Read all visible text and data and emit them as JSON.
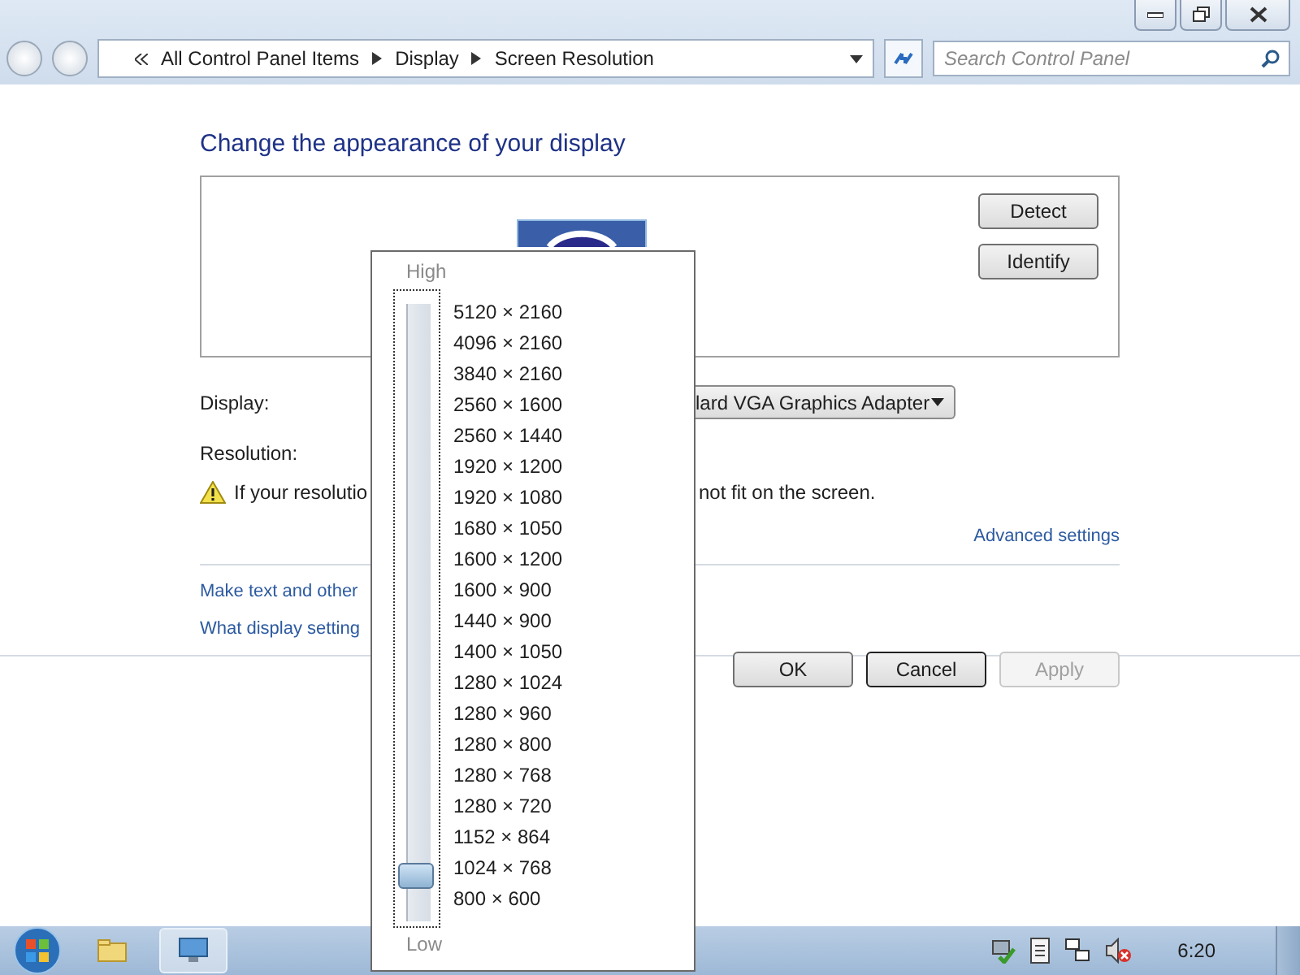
{
  "window": {
    "breadcrumb": [
      "All Control Panel Items",
      "Display",
      "Screen Resolution"
    ],
    "search": {
      "placeholder": "Search Control Panel"
    }
  },
  "heading": "Change the appearance of your display",
  "preview_buttons": [
    "Detect",
    "Identify"
  ],
  "display": {
    "label": "Display:",
    "value": "lard VGA Graphics Adapter"
  },
  "resolution": {
    "label": "Resolution:"
  },
  "warning": {
    "left": "If your resolutio",
    "right": "not fit on the screen."
  },
  "advanced_link": "Advanced settings",
  "links": [
    "Make text and other",
    "What display setting"
  ],
  "dialog_buttons": [
    {
      "label": "OK",
      "disabled": false
    },
    {
      "label": "Cancel",
      "disabled": false
    },
    {
      "label": "Apply",
      "disabled": true
    }
  ],
  "resolution_popup": {
    "high": "High",
    "low": "Low",
    "level": 0.0526,
    "options": [
      "5120 × 2160",
      "4096 × 2160",
      "3840 × 2160",
      "2560 × 1600",
      "2560 × 1440",
      "1920 × 1200",
      "1920 × 1080",
      "1680 × 1050",
      "1600 × 1200",
      "1600 × 900",
      "1440 × 900",
      "1400 × 1050",
      "1280 × 1024",
      "1280 × 960",
      "1280 × 800",
      "1280 × 768",
      "1280 × 720",
      "1152 × 864",
      "1024 × 768",
      "800 × 600"
    ]
  },
  "taskbar": {
    "clock": "6:20"
  }
}
